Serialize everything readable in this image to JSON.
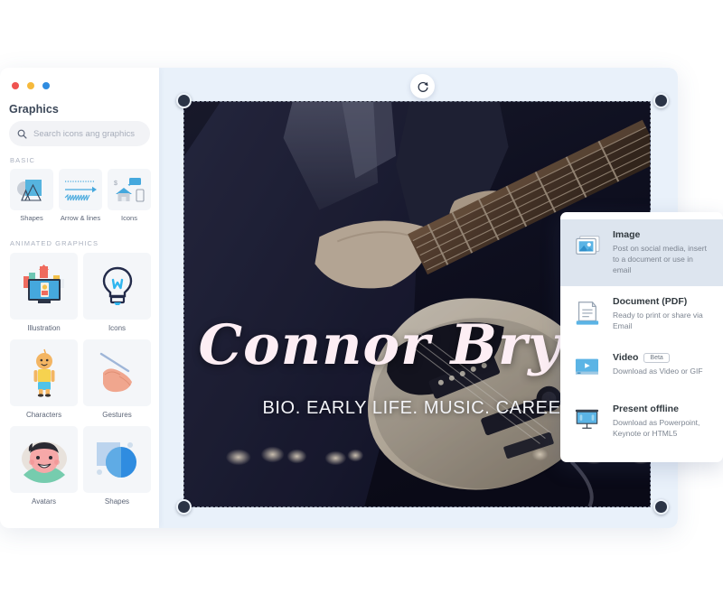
{
  "window": {
    "traffic_lights": [
      "red",
      "yellow",
      "blue"
    ],
    "panel_title": "Graphics"
  },
  "search": {
    "placeholder": "Search icons ang graphics",
    "value": "",
    "icon": "search-icon"
  },
  "sidebar": {
    "sections": [
      {
        "label": "BASIC",
        "items": [
          {
            "label": "Shapes",
            "icon": "shapes-thumbnail"
          },
          {
            "label": "Arrow & lines",
            "icon": "arrows-lines-thumbnail"
          },
          {
            "label": "Icons",
            "icon": "icons-thumbnail"
          }
        ]
      },
      {
        "label": "ANIMATED GRAPHICS",
        "items": [
          {
            "label": "Illustration",
            "icon": "illustration-thumbnail"
          },
          {
            "label": "Icons",
            "icon": "lightbulb-icon-thumbnail"
          },
          {
            "label": "Characters",
            "icon": "character-thumbnail"
          },
          {
            "label": "Gestures",
            "icon": "hand-gesture-thumbnail"
          },
          {
            "label": "Avatars",
            "icon": "avatar-face-thumbnail"
          },
          {
            "label": "Shapes",
            "icon": "shapes-circle-square-thumbnail"
          }
        ]
      }
    ]
  },
  "canvas": {
    "rotate_icon": "refresh-rotate-icon",
    "artboard": {
      "title": "Connor Bryan",
      "subtitle": "BIO. EARLY LIFE. MUSIC. CAREER",
      "selected": true,
      "handles": 4
    }
  },
  "export_menu": {
    "items": [
      {
        "title": "Image",
        "description": "Post on social media, insert to a document or use in email",
        "icon": "image-icon",
        "badge": "",
        "active": true
      },
      {
        "title": "Document (PDF)",
        "description": "Ready to print or share via Email",
        "icon": "document-pdf-icon",
        "badge": "",
        "active": false
      },
      {
        "title": "Video",
        "description": "Download as Video or GIF",
        "icon": "video-player-icon",
        "badge": "Beta",
        "active": false
      },
      {
        "title": "Present offline",
        "description": "Download as Powerpoint, Keynote or HTML5",
        "icon": "presentation-screen-icon",
        "badge": "",
        "active": false
      }
    ]
  },
  "colors": {
    "accent_blue": "#45a8dd",
    "canvas_bg": "#e9f1fa",
    "panel_bg": "#ffffff",
    "thumb_bg": "#f4f6f9",
    "handle": "#2b3446",
    "active_row": "#dde5ef"
  }
}
